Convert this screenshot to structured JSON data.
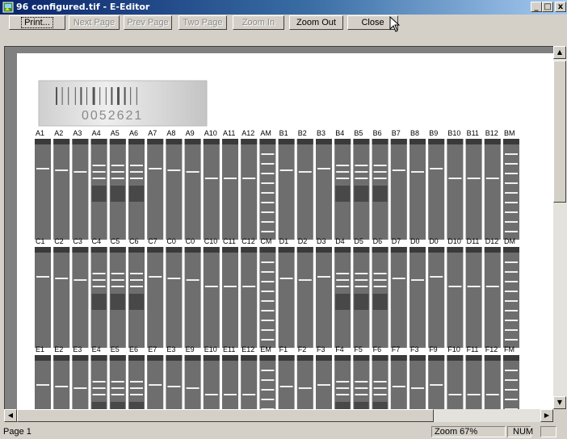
{
  "window": {
    "title": "96 configured.tif - E-Editor",
    "min_label": "_",
    "max_label": "□",
    "close_label": "x"
  },
  "toolbar": {
    "print": "Print...",
    "next_page": "Next Page",
    "prev_page": "Prev Page",
    "two_page": "Two Page",
    "zoom_in": "Zoom In",
    "zoom_out": "Zoom Out",
    "close": "Close"
  },
  "document": {
    "barcode_number": "0052621",
    "rows": [
      {
        "labels": [
          "A1",
          "A2",
          "A3",
          "A4",
          "A5",
          "A6",
          "A7",
          "A8",
          "A9",
          "A10",
          "A11",
          "A12",
          "AM",
          "B1",
          "B2",
          "B3",
          "B4",
          "B5",
          "B6",
          "B7",
          "B8",
          "B9",
          "B10",
          "B11",
          "B12",
          "BM"
        ]
      },
      {
        "labels": [
          "C1",
          "C2",
          "C3",
          "C4",
          "C5",
          "C6",
          "C7",
          "C0",
          "C0",
          "C10",
          "C11",
          "C12",
          "CM",
          "D1",
          "D2",
          "D3",
          "D4",
          "D5",
          "D6",
          "D7",
          "D0",
          "D0",
          "D10",
          "D11",
          "D12",
          "DM"
        ]
      },
      {
        "labels": [
          "E1",
          "E2",
          "E3",
          "E4",
          "E5",
          "E6",
          "E7",
          "E3",
          "E9",
          "E10",
          "E11",
          "E12",
          "EM",
          "F1",
          "F2",
          "F3",
          "F4",
          "F5",
          "F6",
          "F7",
          "F3",
          "F9",
          "F10",
          "F11",
          "F12",
          "FM"
        ]
      }
    ]
  },
  "status": {
    "page": "Page 1",
    "zoom": "Zoom 67%",
    "num": "NUM"
  },
  "colors": {
    "title_active_start": "#0a246a",
    "title_active_end": "#a6caf0",
    "chrome": "#d4d0c8",
    "workspace": "#808080"
  },
  "icons": {
    "app": "image-file-icon",
    "minimize": "minimize-icon",
    "maximize": "maximize-icon",
    "close": "close-icon",
    "cursor": "mouse-pointer-icon"
  }
}
